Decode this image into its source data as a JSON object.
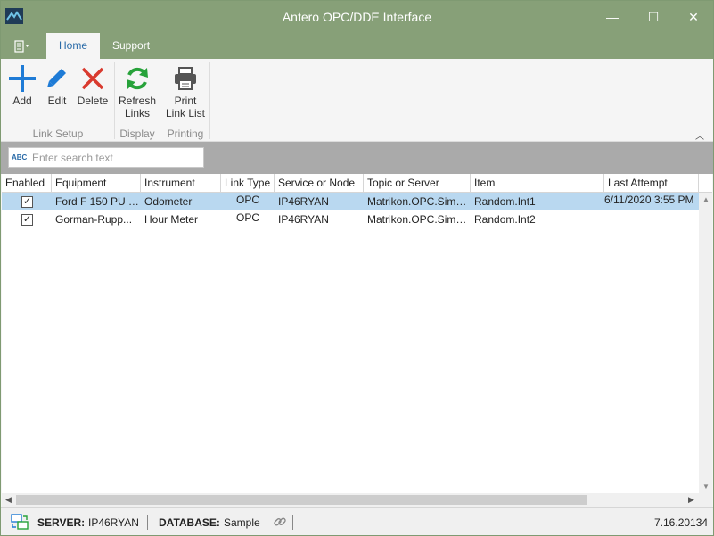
{
  "window": {
    "title": "Antero OPC/DDE Interface",
    "minimize_glyph": "—",
    "maximize_glyph": "☐",
    "close_glyph": "✕"
  },
  "ribbon": {
    "tabs": [
      "Home",
      "Support"
    ],
    "buttons": {
      "add": "Add",
      "edit": "Edit",
      "delete": "Delete",
      "refresh_line1": "Refresh",
      "refresh_line2": "Links",
      "print_line1": "Print",
      "print_line2": "Link List"
    },
    "groups": {
      "link_setup": "Link Setup",
      "display": "Display",
      "printing": "Printing"
    },
    "colors": {
      "add": "#1e7bd6",
      "edit": "#1e7bd6",
      "delete": "#d93a2e",
      "refresh": "#27a23a",
      "print": "#555555"
    }
  },
  "search": {
    "icon_text": "ABC",
    "placeholder": "Enter search text",
    "value": ""
  },
  "grid": {
    "columns": [
      "Enabled",
      "Equipment",
      "Instrument",
      "Link Type",
      "Service or Node",
      "Topic or Server",
      "Item",
      "Last Attempt"
    ],
    "rows": [
      {
        "enabled": "✓",
        "equipment": "Ford F 150 PU T...",
        "instrument": "Odometer",
        "link_type": "OPC",
        "service": "IP46RYAN",
        "topic": "Matrikon.OPC.Simu...",
        "item": "Random.Int1",
        "last_attempt": "6/11/2020 3:55 PM",
        "selected": true
      },
      {
        "enabled": "✓",
        "equipment": "Gorman-Rupp...",
        "instrument": "Hour Meter",
        "link_type": "OPC",
        "service": "IP46RYAN",
        "topic": "Matrikon.OPC.Simu...",
        "item": "Random.Int2",
        "last_attempt": "",
        "selected": false
      }
    ]
  },
  "status": {
    "server_label": "SERVER:",
    "server_value": "IP46RYAN",
    "database_label": "DATABASE:",
    "database_value": "Sample",
    "version": "7.16.20134"
  }
}
